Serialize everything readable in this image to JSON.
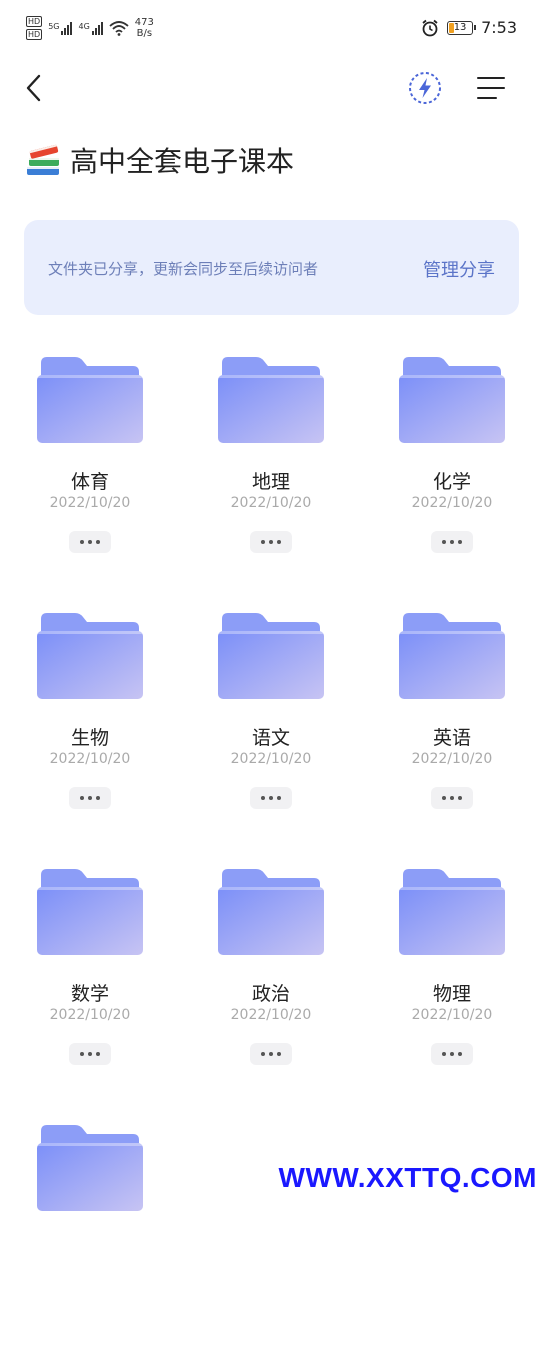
{
  "status_bar": {
    "sim1": "HD",
    "sim2": "HD",
    "signal1_tag": "5G",
    "signal2_tag": "4G",
    "net_speed_value": "473",
    "net_speed_unit": "B/s",
    "battery_level": "13",
    "time": "7:53"
  },
  "nav": {
    "icons": [
      "back-icon",
      "lightning-icon",
      "menu-icon"
    ]
  },
  "page": {
    "title_emoji": "books-icon",
    "title": "高中全套电子课本"
  },
  "banner": {
    "text": "文件夹已分享，更新会同步至后续访问者",
    "action": "管理分享"
  },
  "folders": [
    {
      "name": "体育",
      "date": "2022/10/20"
    },
    {
      "name": "地理",
      "date": "2022/10/20"
    },
    {
      "name": "化学",
      "date": "2022/10/20"
    },
    {
      "name": "生物",
      "date": "2022/10/20"
    },
    {
      "name": "语文",
      "date": "2022/10/20"
    },
    {
      "name": "英语",
      "date": "2022/10/20"
    },
    {
      "name": "数学",
      "date": "2022/10/20"
    },
    {
      "name": "政治",
      "date": "2022/10/20"
    },
    {
      "name": "物理",
      "date": "2022/10/20"
    },
    {
      "name": "",
      "date": ""
    }
  ],
  "colors": {
    "folder_front_start": "#7b8ff8",
    "folder_front_end": "#c7c4f3",
    "folder_back": "#8c9df7",
    "banner_bg": "#e9eefd",
    "accent": "#5b74c8"
  },
  "watermark": "WWW.XXTTQ.COM"
}
